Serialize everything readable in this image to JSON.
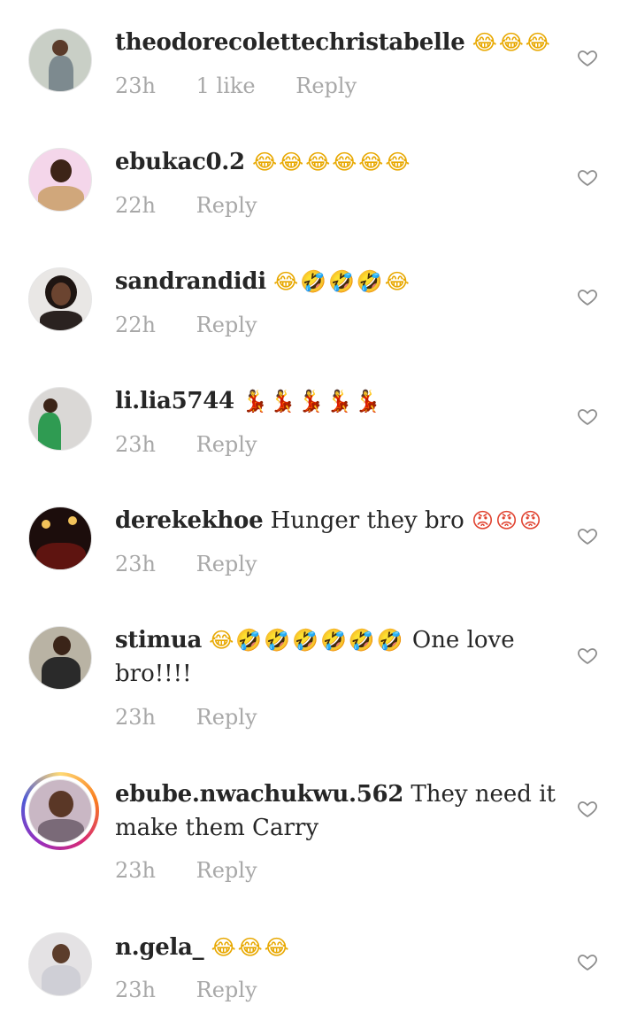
{
  "comments": [
    {
      "username": "theodorecolettechristabelle",
      "text": "",
      "emoji": "😂😂😂",
      "emoji_kind": "laugh",
      "time": "23h",
      "likes": "1 like",
      "reply": "Reply",
      "avatar": {
        "bg": "#c9cfc6",
        "skin": "#5a3b2a",
        "shirt": "#7d8a8f"
      }
    },
    {
      "username": "ebukac0.2",
      "text": "",
      "emoji": "😂😂😂😂😂😂",
      "emoji_kind": "laugh",
      "time": "22h",
      "likes": "",
      "reply": "Reply",
      "avatar": {
        "bg": "#f4d6ea",
        "skin": "#3d2417",
        "shirt": "#d0a77b"
      }
    },
    {
      "username": "sandrandidi",
      "text": "",
      "emoji": "😂🤣🤣🤣😂",
      "emoji_kind": "laugh",
      "time": "22h",
      "likes": "",
      "reply": "Reply",
      "avatar": {
        "bg": "#e9e7e5",
        "skin": "#6b4430",
        "shirt": "#2a2220"
      }
    },
    {
      "username": "li.lia5744",
      "text": "",
      "emoji": "💃💃💃💃💃",
      "emoji_kind": "dance",
      "time": "23h",
      "likes": "",
      "reply": "Reply",
      "avatar": {
        "bg": "#dad8d6",
        "skin": "#3b2418",
        "shirt": "#2f9b52"
      }
    },
    {
      "username": "derekekhoe",
      "text": "Hunger they bro",
      "emoji": "😡😡😡",
      "emoji_kind": "angry",
      "time": "23h",
      "likes": "",
      "reply": "Reply",
      "avatar": {
        "bg": "#1c0d0c",
        "skin": "#b83a1c",
        "shirt": "#5e1410"
      }
    },
    {
      "username": "stimua",
      "text": "",
      "emoji": "😂🤣🤣🤣🤣🤣🤣",
      "emoji_kind": "laugh",
      "text_after": "One love bro!!!!",
      "time": "23h",
      "likes": "",
      "reply": "Reply",
      "avatar": {
        "bg": "#b9b3a4",
        "skin": "#3a2418",
        "shirt": "#2a2a2a"
      }
    },
    {
      "username": "ebube.nwachukwu.562",
      "text": "They need it make them Carry",
      "emoji": "",
      "emoji_kind": "",
      "time": "23h",
      "likes": "",
      "reply": "Reply",
      "has_story_ring": true,
      "avatar": {
        "bg": "#c9b7c4",
        "skin": "#5a3726",
        "shirt": "#7a6a78"
      }
    },
    {
      "username": "n.gela_",
      "text": "",
      "emoji": "😂😂😂",
      "emoji_kind": "laugh",
      "time": "23h",
      "likes": "",
      "reply": "Reply",
      "avatar": {
        "bg": "#e4e2e4",
        "skin": "#5c3d2b",
        "shirt": "#cfcfd6"
      }
    }
  ]
}
